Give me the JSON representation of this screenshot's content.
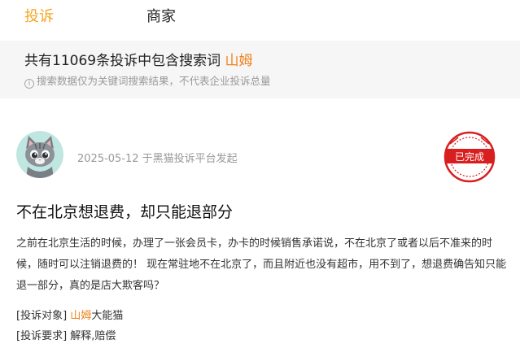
{
  "tabs": [
    {
      "label": "投诉",
      "active": true
    },
    {
      "label": "商家",
      "active": false
    }
  ],
  "summary": {
    "prefix": "共有11069条投诉中包含搜索词",
    "keyword": "山姆",
    "note": "搜索数据仅为关键词搜索结果，不代表企业投诉总量",
    "note_icon": "info-icon"
  },
  "complaint": {
    "avatar_icon": "cat-avatar-icon",
    "meta": "2025-05-12 于黑猫投诉平台发起",
    "status": "已完成",
    "title": "不在北京想退费，却只能退部分",
    "content": "之前在北京生活的时候，办理了一张会员卡，办卡的时候销售承诺说，不在北京了或者以后不准来的时候，随时可以注销退费的！ 现在常驻地不在北京了，而且附近也没有超市，用不到了，想退费确告知只能退一部分，真的是店大欺客吗？",
    "target_label": "[投诉对象]",
    "target_keyword": "山姆",
    "target_rest": "大能猫",
    "demand_label": "[投诉要求]",
    "demand_value": "解释,赔偿"
  },
  "colors": {
    "accent": "#f5a623",
    "keyword": "#f0801a",
    "stamp": "#d81e1e"
  }
}
